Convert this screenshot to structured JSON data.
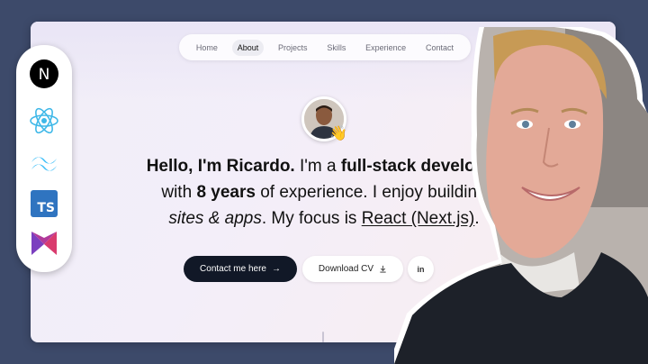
{
  "nav": {
    "items": [
      {
        "label": "Home",
        "active": false
      },
      {
        "label": "About",
        "active": true
      },
      {
        "label": "Projects",
        "active": false
      },
      {
        "label": "Skills",
        "active": false
      },
      {
        "label": "Experience",
        "active": false
      },
      {
        "label": "Contact",
        "active": false
      }
    ]
  },
  "hero": {
    "greeting": "Hello, I'm Ricardo.",
    "role_prefix": " I'm a ",
    "role": "full-stack developer",
    "line2_prefix": "with ",
    "years": "8 years",
    "line2_suffix": " of experience. I enjoy building",
    "sites": "sites & apps",
    "focus_prefix": ". My focus is ",
    "focus": "React (Next.js)",
    "focus_suffix": "."
  },
  "buttons": {
    "contact_label": "Contact me here",
    "cv_label": "Download CV",
    "linkedin_label": "in"
  },
  "tech_stack": {
    "nextjs_letter": "N",
    "typescript_label": "TS",
    "icons": [
      "nextjs-icon",
      "react-icon",
      "tailwind-icon",
      "typescript-icon",
      "framer-motion-icon"
    ],
    "colors": {
      "react": "#61dafb",
      "tailwind": "#38bdf8",
      "typescript": "#2f74c0",
      "framer_top": "#d93b6e",
      "framer_bottom": "#7b3fbf"
    }
  },
  "colors": {
    "background": "#3d4a6a",
    "primary_button": "#111827"
  }
}
